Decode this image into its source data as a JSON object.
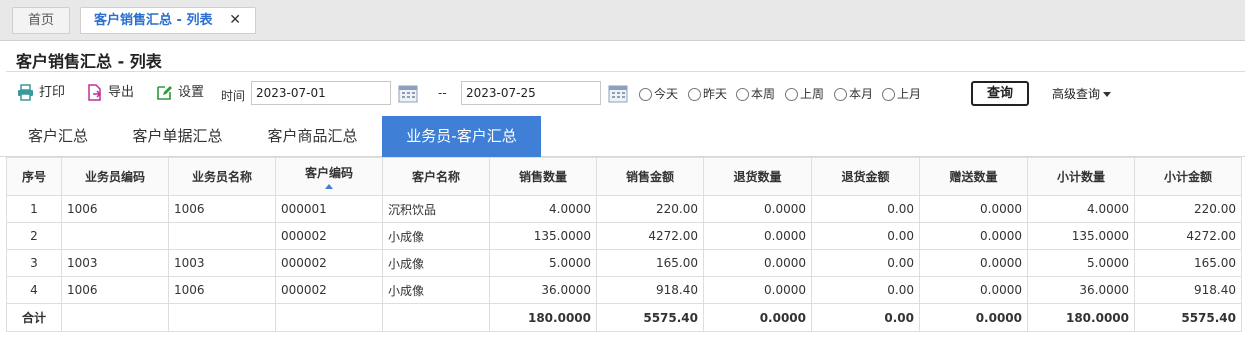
{
  "tabs": {
    "home": "首页",
    "active": "客户销售汇总 - 列表",
    "close": "✕"
  },
  "page_title": "客户销售汇总 - 列表",
  "toolbar": {
    "print": "打印",
    "export": "导出",
    "settings": "设置",
    "time_label": "时间",
    "date_from": "2023-07-01",
    "date_separator": "--",
    "date_to": "2023-07-25",
    "quick_ranges": [
      "今天",
      "昨天",
      "本周",
      "上周",
      "本月",
      "上月"
    ],
    "query": "查询",
    "advanced_query": "高级查询",
    "accent_color": "#3f7fd6"
  },
  "subtabs": [
    "客户汇总",
    "客户单据汇总",
    "客户商品汇总",
    "业务员-客户汇总"
  ],
  "table": {
    "headers": [
      "序号",
      "业务员编码",
      "业务员名称",
      "客户编码",
      "客户名称",
      "销售数量",
      "销售金额",
      "退货数量",
      "退货金额",
      "赠送数量",
      "小计数量",
      "小计金额"
    ],
    "sorted_column": "客户编码",
    "rows": [
      [
        "1",
        "1006",
        "1006",
        "000001",
        "沉积饮品",
        "4.0000",
        "220.00",
        "0.0000",
        "0.00",
        "0.0000",
        "4.0000",
        "220.00"
      ],
      [
        "2",
        "",
        "",
        "000002",
        "小成像",
        "135.0000",
        "4272.00",
        "0.0000",
        "0.00",
        "0.0000",
        "135.0000",
        "4272.00"
      ],
      [
        "3",
        "1003",
        "1003",
        "000002",
        "小成像",
        "5.0000",
        "165.00",
        "0.0000",
        "0.00",
        "0.0000",
        "5.0000",
        "165.00"
      ],
      [
        "4",
        "1006",
        "1006",
        "000002",
        "小成像",
        "36.0000",
        "918.40",
        "0.0000",
        "0.00",
        "0.0000",
        "36.0000",
        "918.40"
      ]
    ],
    "total_row": [
      "合计",
      "",
      "",
      "",
      "",
      "180.0000",
      "5575.40",
      "0.0000",
      "0.00",
      "0.0000",
      "180.0000",
      "5575.40"
    ]
  }
}
